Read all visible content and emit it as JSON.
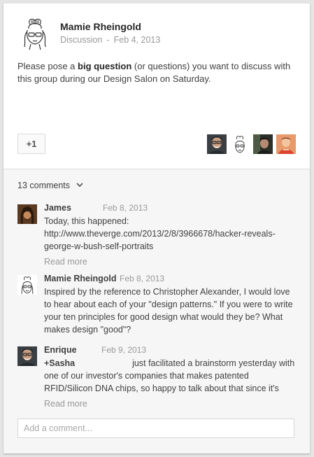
{
  "post": {
    "author_name": "Mamie Rheingold",
    "category": "Discussion",
    "separator": "-",
    "date": "Feb 4, 2013",
    "text_before": "Please pose a ",
    "text_bold": "big question",
    "text_after": " (or questions) you want to discuss with this group during our Design Salon on Saturday.",
    "plusone_label": "+1"
  },
  "comments_summary": {
    "label": "13 comments"
  },
  "comments": [
    {
      "author": "James",
      "date": "Feb 8, 2013",
      "text": "Today, this happened: http://www.theverge.com/2013/2/8/3966678/hacker-reveals-george-w-bush-self-portraits",
      "read_more": "Read more"
    },
    {
      "author": "Mamie Rheingold",
      "date": "Feb 8, 2013",
      "text": "Inspired by the reference to Christopher Alexander, I would love to hear about each of your \"design patterns.\" If you were to write your ten principles for good design what would they be? What makes design \"good\"?"
    },
    {
      "author": "Enrique",
      "date": "Feb 9, 2013",
      "mention": "+Sasha",
      "text": "just facilitated a brainstorm yesterday with one of our investor's companies that makes patented RFID/Silicon DNA chips, so happy to talk about that since it's",
      "read_more": "Read more"
    }
  ],
  "add_comment": {
    "placeholder": "Add a comment..."
  },
  "colors": {
    "card_background": "#f6f6f6",
    "post_background": "#ffffff",
    "muted_text": "#999999",
    "body_text": "#404040"
  }
}
